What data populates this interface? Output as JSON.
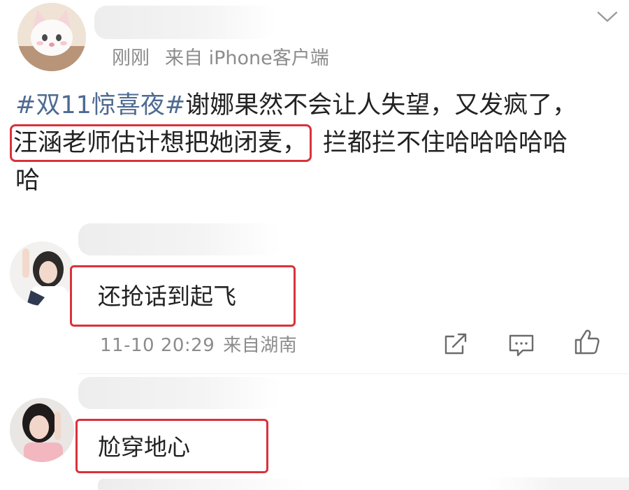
{
  "post": {
    "time": "刚刚",
    "source": "来自 iPhone客户端",
    "hashtag": "#双11惊喜夜#",
    "line1_rest": "谢娜果然不会让人失望，又发疯了，",
    "line2_highlight": "汪涵老师估计想把她闭麦，",
    "line2_rest": "拦都拦不住哈哈哈哈哈",
    "line3": "哈"
  },
  "comments": [
    {
      "text": "还抢话到起飞",
      "time": "11-10 20:29",
      "location": "来自湖南"
    },
    {
      "text": "尬穿地心"
    }
  ],
  "icons": {
    "menu": "chevron-down-icon",
    "share": "share-icon",
    "comment": "comment-icon",
    "like": "thumbs-up-icon"
  },
  "colors": {
    "highlight": "#d9323a",
    "hashtag": "#4e6a91",
    "meta": "#8c8c8c",
    "text": "#222222"
  }
}
